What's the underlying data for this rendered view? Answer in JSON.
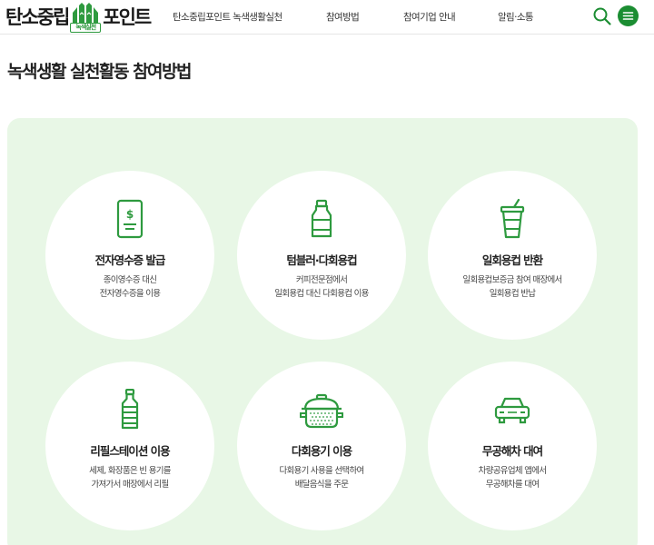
{
  "header": {
    "logo": {
      "left_text": "탄소중립",
      "right_text": "포인트",
      "sub_text": "녹색실천"
    },
    "nav": [
      {
        "label": "탄소중립포인트 녹색생활실천"
      },
      {
        "label": "참여방법"
      },
      {
        "label": "참여기업 안내"
      },
      {
        "label": "알림·소통"
      }
    ],
    "icons": {
      "search": "search-icon",
      "menu": "hamburger-menu-icon"
    },
    "brand_color": "#1b8d32"
  },
  "page_title": "녹색생활 실천활동 참여방법",
  "colors": {
    "panel_bg": "#e8f7e6",
    "card_bg": "#ffffff",
    "icon_green": "#2e9a3f"
  },
  "cards": [
    {
      "icon": "e-receipt-icon",
      "title": "전자영수증 발급",
      "desc": [
        "종이영수증 대신",
        "전자영수증을 이용"
      ]
    },
    {
      "icon": "tumbler-bottle-icon",
      "title": "텀블러·다회용컵",
      "desc": [
        "커피전문점에서",
        "일회용컵 대신 다회용컵 이용"
      ]
    },
    {
      "icon": "disposable-cup-icon",
      "title": "일회용컵 반환",
      "desc": [
        "일회용컵보증금 참여 매장에서",
        "일회용컵 반납"
      ]
    },
    {
      "icon": "refill-bottle-icon",
      "title": "리필스테이션 이용",
      "desc": [
        "세제, 화장품은 빈 용기를",
        "가져가서 매장에서 리필"
      ]
    },
    {
      "icon": "cooking-pot-icon",
      "title": "다회용기 이용",
      "desc": [
        "다회용기 사용을 선택하여",
        "배달음식을 주문"
      ]
    },
    {
      "icon": "car-icon",
      "title": "무공해차 대여",
      "desc": [
        "차량공유업체 앱에서",
        "무공해차를 대여"
      ]
    }
  ]
}
